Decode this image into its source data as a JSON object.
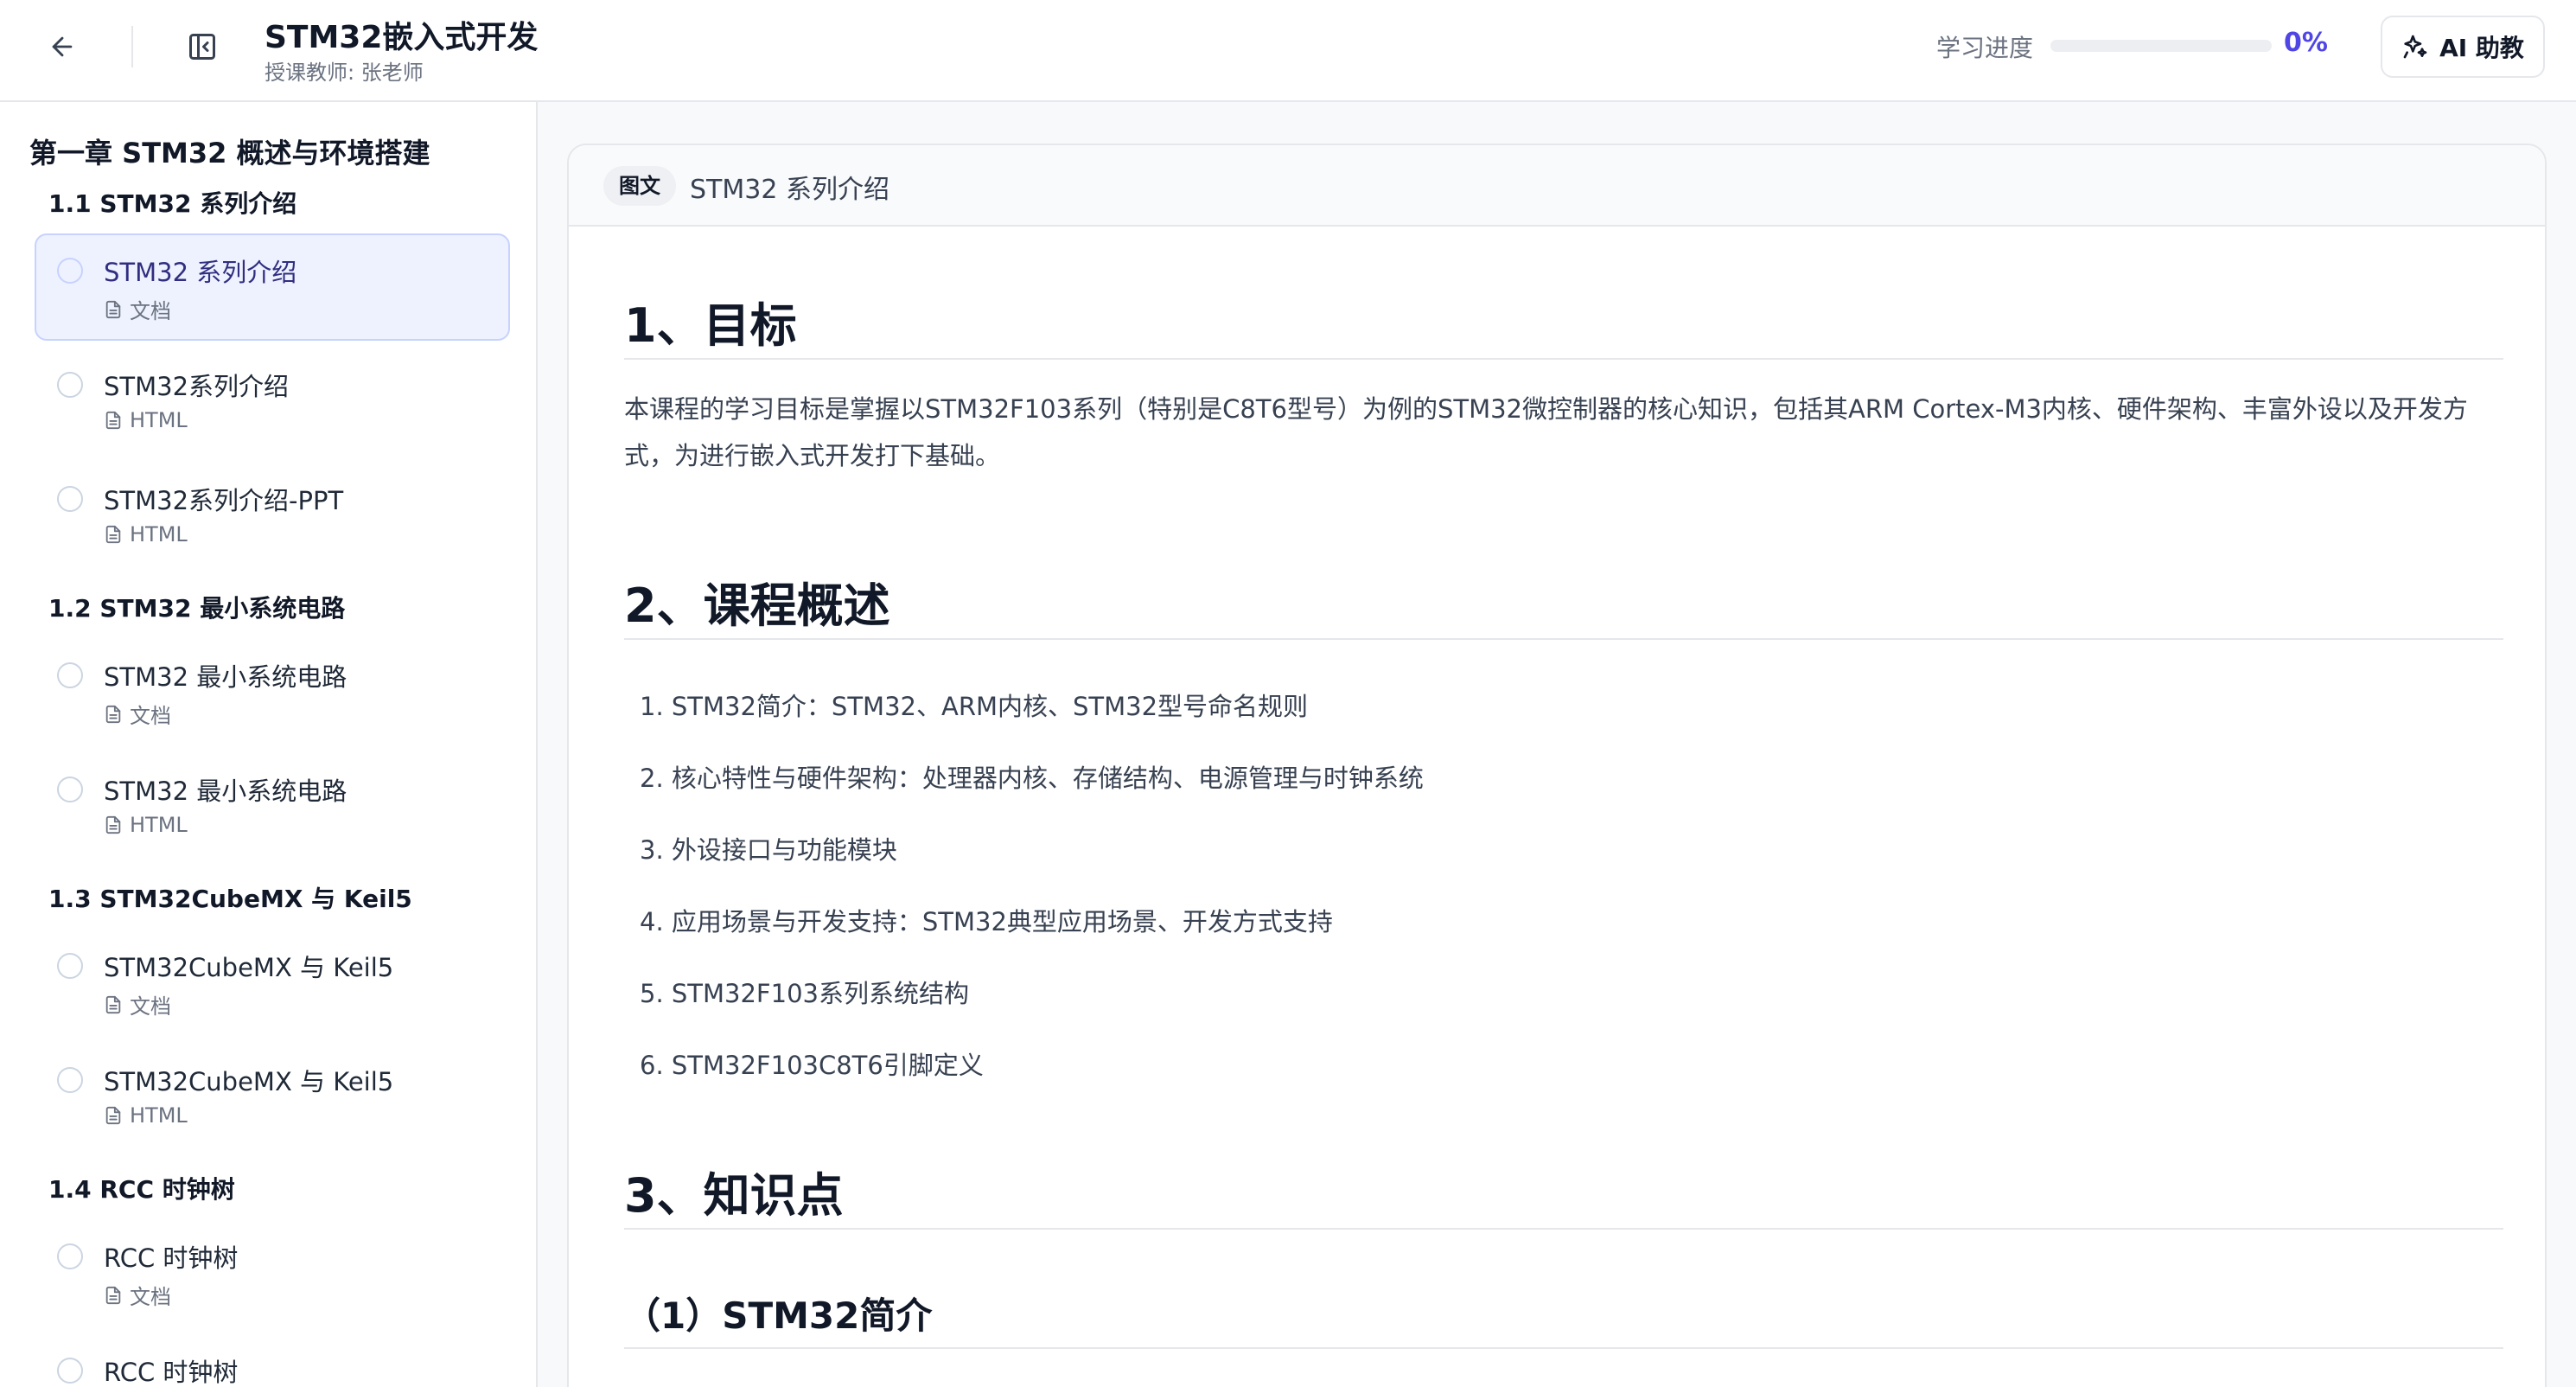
{
  "header": {
    "back_icon": "arrow-left-icon",
    "toggle_icon": "sidebar-collapse-icon",
    "course_title": "STM32嵌入式开发",
    "teacher": "授课教师: 张老师",
    "progress_label": "学习进度",
    "progress_value": "0%",
    "progress_fraction": 0,
    "ai_button_label": "AI 助教",
    "ai_icon": "sparkle-icon",
    "accent_color": "#4f46e5"
  },
  "sidebar": {
    "chapter_title": "第一章 STM32 概述与环境搭建",
    "sections": [
      {
        "title": "1.1 STM32 系列介绍",
        "lessons": [
          {
            "title": "STM32 系列介绍",
            "type": "文档",
            "active": true
          },
          {
            "title": "STM32系列介绍",
            "type": "HTML",
            "active": false
          },
          {
            "title": "STM32系列介绍-PPT",
            "type": "HTML",
            "active": false
          }
        ]
      },
      {
        "title": "1.2 STM32 最小系统电路",
        "lessons": [
          {
            "title": "STM32 最小系统电路",
            "type": "文档",
            "active": false
          },
          {
            "title": "STM32 最小系统电路",
            "type": "HTML",
            "active": false
          }
        ]
      },
      {
        "title": "1.3 STM32CubeMX 与 Keil5",
        "lessons": [
          {
            "title": "STM32CubeMX 与 Keil5",
            "type": "文档",
            "active": false
          },
          {
            "title": "STM32CubeMX 与 Keil5",
            "type": "HTML",
            "active": false
          }
        ]
      },
      {
        "title": "1.4 RCC 时钟树",
        "lessons": [
          {
            "title": "RCC 时钟树",
            "type": "文档",
            "active": false
          },
          {
            "title": "RCC 时钟树",
            "type": "HTML",
            "active": false
          }
        ]
      }
    ]
  },
  "content": {
    "badge": "图文",
    "title": "STM32 系列介绍",
    "heading1": "1、目标",
    "objective": "本课程的学习目标是掌握以STM32F103系列（特别是C8T6型号）为例的STM32微控制器的核心知识，包括其ARM Cortex-M3内核、硬件架构、丰富外设以及开发方式，为进行嵌入式开发打下基础。",
    "heading2": "2、课程概述",
    "overview": [
      "1. STM32简介：STM32、ARM内核、STM32型号命名规则",
      "2. 核心特性与硬件架构：处理器内核、存储结构、电源管理与时钟系统",
      "3. 外设接口与功能模块",
      "4. 应用场景与开发支持：STM32典型应用场景、开发方式支持",
      "5. STM32F103系列系统结构",
      "6. STM32F103C8T6引脚定义"
    ],
    "heading3": "3、知识点",
    "subheading1": "（1）STM32简介"
  }
}
